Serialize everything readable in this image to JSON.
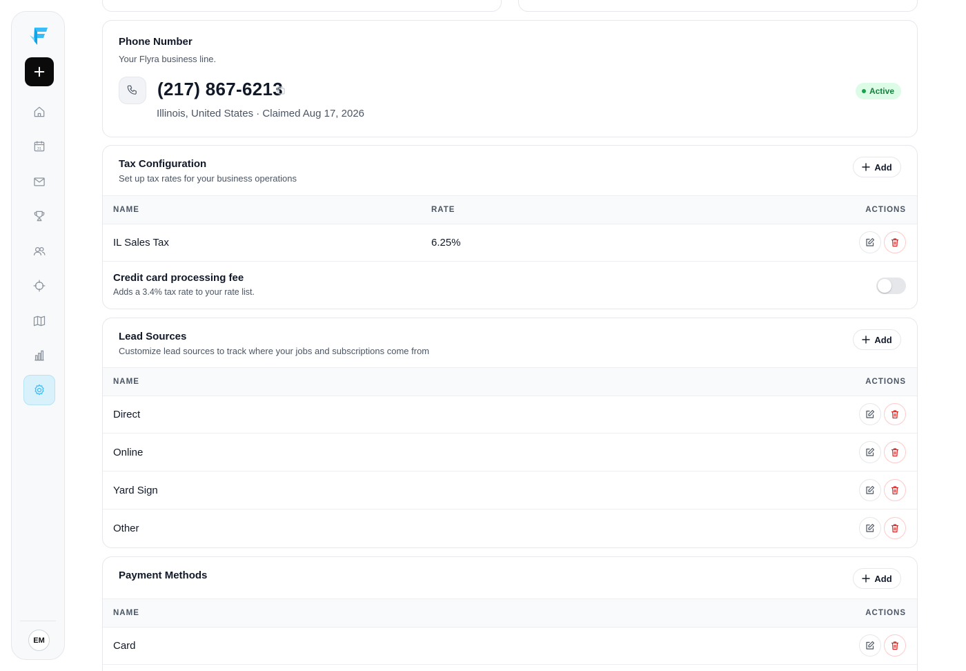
{
  "sidebar": {
    "new_label": "+",
    "nav": [
      "home",
      "calendar",
      "messages",
      "achievements",
      "customers",
      "targets",
      "map",
      "reports",
      "settings"
    ],
    "active": "settings",
    "avatar_initials": "EM"
  },
  "phone": {
    "title": "Phone Number",
    "subtitle": "Your Flyra business line.",
    "number": "(217) 867-6213",
    "meta": "Illinois, United States · Claimed Aug 17, 2026",
    "status": "Active"
  },
  "tax": {
    "title": "Tax Configuration",
    "subtitle": "Set up tax rates for your business operations",
    "add_label": "Add",
    "columns": [
      "NAME",
      "RATE",
      "ACTIONS"
    ],
    "rows": [
      {
        "name": "IL Sales Tax",
        "rate": "6.25%"
      }
    ],
    "fee": {
      "title": "Credit card processing fee",
      "subtitle": "Adds a 3.4% tax rate to your rate list.",
      "enabled": false
    }
  },
  "lead_sources": {
    "title": "Lead Sources",
    "subtitle": "Customize lead sources to track where your jobs and subscriptions come from",
    "add_label": "Add",
    "columns": [
      "NAME",
      "ACTIONS"
    ],
    "rows": [
      {
        "name": "Direct"
      },
      {
        "name": "Online"
      },
      {
        "name": "Yard Sign"
      },
      {
        "name": "Other"
      }
    ]
  },
  "payment_methods": {
    "title": "Payment Methods",
    "add_label": "Add",
    "columns": [
      "NAME",
      "ACTIONS"
    ],
    "rows": [
      {
        "name": "Card"
      }
    ]
  },
  "colors": {
    "accent": "#38bdf8",
    "danger": "#dc2626",
    "success": "#16a34a"
  }
}
